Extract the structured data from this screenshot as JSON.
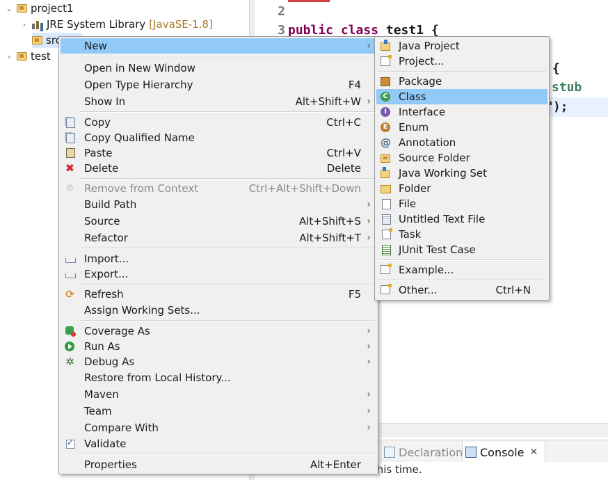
{
  "explorer": {
    "items": [
      {
        "label": "project1",
        "twisty": "⌄"
      },
      {
        "label": "JRE System Library",
        "tag": "[JavaSE-1.8]",
        "twisty": "›"
      },
      {
        "label": "src"
      },
      {
        "label": "test",
        "twisty": "›"
      }
    ]
  },
  "editor": {
    "lines": [
      {
        "num": "2",
        "text": ""
      },
      {
        "num": "3",
        "keywords": "public class",
        "rest": " test1 {"
      }
    ],
    "fragments": {
      "brace": "{",
      "stub": "stub",
      "paren_end": "\");"
    }
  },
  "bottom": {
    "tab_declaration": "Declaration",
    "tab_console": "Console",
    "console_close": "✕",
    "console_text": "ot this time."
  },
  "context_menu": {
    "items": [
      {
        "label": "New",
        "shortcut": "",
        "submenu": true,
        "icon": ""
      },
      {
        "label": "Open in New Window",
        "shortcut": "",
        "icon": ""
      },
      {
        "label": "Open Type Hierarchy",
        "shortcut": "F4",
        "icon": ""
      },
      {
        "label": "Show In",
        "shortcut": "Alt+Shift+W",
        "submenu": true,
        "icon": ""
      },
      {
        "label": "Copy",
        "shortcut": "Ctrl+C",
        "icon": "copy-icon"
      },
      {
        "label": "Copy Qualified Name",
        "shortcut": "",
        "icon": "copy-qualified-name-icon"
      },
      {
        "label": "Paste",
        "shortcut": "Ctrl+V",
        "icon": "paste-icon"
      },
      {
        "label": "Delete",
        "shortcut": "Delete",
        "icon": "delete-icon"
      },
      {
        "label": "Remove from Context",
        "shortcut": "Ctrl+Alt+Shift+Down",
        "disabled": true,
        "icon": "remove-context-icon"
      },
      {
        "label": "Build Path",
        "shortcut": "",
        "submenu": true,
        "icon": ""
      },
      {
        "label": "Source",
        "shortcut": "Alt+Shift+S",
        "submenu": true,
        "icon": ""
      },
      {
        "label": "Refactor",
        "shortcut": "Alt+Shift+T",
        "submenu": true,
        "icon": ""
      },
      {
        "label": "Import...",
        "shortcut": "",
        "icon": "import-icon"
      },
      {
        "label": "Export...",
        "shortcut": "",
        "icon": "export-icon"
      },
      {
        "label": "Refresh",
        "shortcut": "F5",
        "icon": "refresh-icon"
      },
      {
        "label": "Assign Working Sets...",
        "shortcut": "",
        "icon": ""
      },
      {
        "label": "Coverage As",
        "shortcut": "",
        "submenu": true,
        "icon": "coverage-icon"
      },
      {
        "label": "Run As",
        "shortcut": "",
        "submenu": true,
        "icon": "run-icon"
      },
      {
        "label": "Debug As",
        "shortcut": "",
        "submenu": true,
        "icon": "debug-icon"
      },
      {
        "label": "Restore from Local History...",
        "shortcut": "",
        "icon": ""
      },
      {
        "label": "Maven",
        "shortcut": "",
        "submenu": true,
        "icon": ""
      },
      {
        "label": "Team",
        "shortcut": "",
        "submenu": true,
        "icon": ""
      },
      {
        "label": "Compare With",
        "shortcut": "",
        "submenu": true,
        "icon": ""
      },
      {
        "label": "Validate",
        "shortcut": "",
        "icon": "validate-check-icon"
      },
      {
        "label": "Properties",
        "shortcut": "Alt+Enter",
        "icon": ""
      }
    ]
  },
  "new_submenu": {
    "items": [
      {
        "label": "Java Project",
        "shortcut": "",
        "icon": "java-project-icon"
      },
      {
        "label": "Project...",
        "shortcut": "",
        "icon": "project-icon"
      },
      {
        "label": "Package",
        "shortcut": "",
        "icon": "package-icon"
      },
      {
        "label": "Class",
        "shortcut": "",
        "icon": "class-icon",
        "icon_letter": "C",
        "highlighted": true
      },
      {
        "label": "Interface",
        "shortcut": "",
        "icon": "interface-icon",
        "icon_letter": "I"
      },
      {
        "label": "Enum",
        "shortcut": "",
        "icon": "enum-icon",
        "icon_letter": "E"
      },
      {
        "label": "Annotation",
        "shortcut": "",
        "icon": "annotation-icon"
      },
      {
        "label": "Source Folder",
        "shortcut": "",
        "icon": "source-folder-icon"
      },
      {
        "label": "Java Working Set",
        "shortcut": "",
        "icon": "java-working-set-icon"
      },
      {
        "label": "Folder",
        "shortcut": "",
        "icon": "folder-icon"
      },
      {
        "label": "File",
        "shortcut": "",
        "icon": "file-icon"
      },
      {
        "label": "Untitled Text File",
        "shortcut": "",
        "icon": "text-file-icon"
      },
      {
        "label": "Task",
        "shortcut": "",
        "icon": "task-icon"
      },
      {
        "label": "JUnit Test Case",
        "shortcut": "",
        "icon": "junit-icon"
      },
      {
        "label": "Example...",
        "shortcut": "",
        "icon": "example-icon"
      },
      {
        "label": "Other...",
        "shortcut": "Ctrl+N",
        "icon": "other-icon"
      }
    ]
  },
  "colors": {
    "menu_bg": "#f0f0f0",
    "highlight": "#91c9f7",
    "keyword": "#7f0055",
    "comment": "#3f7f5f",
    "library_tag": "#a77b24"
  }
}
